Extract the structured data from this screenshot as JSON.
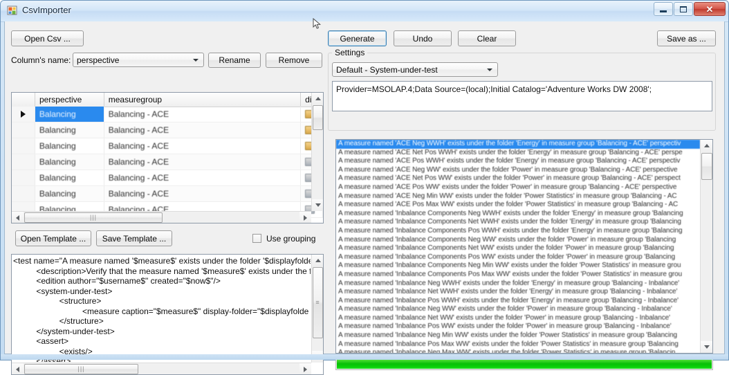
{
  "window": {
    "title": "CsvImporter",
    "icon": "app-window-icon",
    "buttons": {
      "minimize": "minimize-icon",
      "maximize": "maximize-icon",
      "close": "close-icon"
    }
  },
  "toolbar": {
    "open_csv": "Open Csv ...",
    "generate": "Generate",
    "undo": "Undo",
    "clear": "Clear",
    "save_as": "Save as ..."
  },
  "column_row": {
    "label": "Column's name:",
    "combo_value": "perspective",
    "rename": "Rename",
    "remove": "Remove"
  },
  "settings": {
    "group_title": "Settings",
    "profile_combo": "Default - System-under-test",
    "connection_string": "Provider=MSOLAP.4;Data Source=(local);Initial Catalog='Adventure Works DW 2008';"
  },
  "grid": {
    "headers": [
      "",
      "perspective",
      "measuregroup",
      "di"
    ],
    "rows": [
      {
        "perspective": "Balancing",
        "measuregroup": "Balancing - ACE",
        "displayfolder": "folder-icon",
        "selected": true
      },
      {
        "perspective": "Balancing",
        "measuregroup": "Balancing - ACE",
        "displayfolder": "folder-icon",
        "selected": false
      },
      {
        "perspective": "Balancing",
        "measuregroup": "Balancing - ACE",
        "displayfolder": "folder-icon",
        "selected": false
      },
      {
        "perspective": "Balancing",
        "measuregroup": "Balancing - ACE",
        "displayfolder": "folder-icon",
        "selected": false
      },
      {
        "perspective": "Balancing",
        "measuregroup": "Balancing - ACE",
        "displayfolder": "folder-icon",
        "selected": false
      },
      {
        "perspective": "Balancing",
        "measuregroup": "Balancing - ACE",
        "displayfolder": "folder-icon",
        "selected": false
      },
      {
        "perspective": "Balancing",
        "measuregroup": "Balancing - ACE",
        "displayfolder": "folder-icon",
        "selected": false
      }
    ]
  },
  "template_bar": {
    "open_template": "Open Template ...",
    "save_template": "Save Template ...",
    "use_grouping_label": "Use grouping",
    "use_grouping_checked": false
  },
  "template_text": [
    "<test name=\"A measure named '$measure$' exists under the folder '$displayfolder$' in measu",
    "          <description>Verify that the measure named '$measure$' exists under the folder '$d",
    "          <edition author=\"$username$\" created=\"$now$\"/>",
    "          <system-under-test>",
    "                    <structure>",
    "                              <measure caption=\"$measure$\" display-folder=\"$displayfolde",
    "                    </structure>",
    "          </system-under-test>",
    "          <assert>",
    "                    <exists/>",
    "          </assert>"
  ],
  "output_list": {
    "selected_index": 0,
    "items": [
      "A measure named 'ACE Neg WWH' exists under the folder 'Energy' in measure group 'Balancing - ACE' perspectiv",
      "A measure named 'ACE Net Pos WWH' exists under the folder 'Energy' in measure group 'Balancing - ACE' perspe",
      "A measure named 'ACE Pos WWH' exists under the folder 'Energy' in measure group 'Balancing - ACE' perspectiv",
      "A measure named 'ACE Neg WW' exists under the folder 'Power' in measure group 'Balancing - ACE' perspective",
      "A measure named 'ACE Net Pos WW' exists under the folder 'Power' in measure group 'Balancing - ACE' perspect",
      "A measure named 'ACE Pos WW' exists under the folder 'Power' in measure group 'Balancing - ACE' perspective",
      "A measure named 'ACE Neg Min WW' exists under the folder 'Power Statistics' in measure group 'Balancing - AC",
      "A measure named 'ACE Pos Max WW' exists under the folder 'Power Statistics' in measure group 'Balancing - AC",
      "A measure named 'Inbalance Components Neg WWH' exists under the folder 'Energy' in measure group 'Balancing",
      "A measure named 'Inbalance Components Net WWH' exists under the folder 'Energy' in measure group 'Balancing",
      "A measure named 'Inbalance Components Pos WWH' exists under the folder 'Energy' in measure group 'Balancing",
      "A measure named 'Inbalance Components Neg WW' exists under the folder 'Power' in measure group 'Balancing",
      "A measure named 'Inbalance Components Net WW' exists under the folder 'Power' in measure group 'Balancing",
      "A measure named 'Inbalance Components Pos WW' exists under the folder 'Power' in measure group 'Balancing",
      "A measure named 'Inbalance Components Neg Min WW' exists under the folder 'Power Statistics' in measure grou",
      "A measure named 'Inbalance Components Pos Max WW' exists under the folder 'Power Statistics' in measure grou",
      "A measure named 'Inbalance Neg WWH' exists under the folder 'Energy' in measure group 'Balancing - Inbalance'",
      "A measure named 'Inbalance Net WWH' exists under the folder 'Energy' in measure group 'Balancing - Inbalance'",
      "A measure named 'Inbalance Pos WWH' exists under the folder 'Energy' in measure group 'Balancing - Inbalance'",
      "A measure named 'Inbalance Neg WW' exists under the folder 'Power' in measure group 'Balancing - Inbalance'",
      "A measure named 'Inbalance Net WW' exists under the folder 'Power' in measure group 'Balancing - Inbalance'",
      "A measure named 'Inbalance Pos WW' exists under the folder 'Power' in measure group 'Balancing - Inbalance'",
      "A measure named 'Inbalance Neg Min WW' exists under the folder 'Power Statistics' in measure group 'Balancing",
      "A measure named 'Inbalance Pos Max WW' exists under the folder 'Power Statistics' in measure group 'Balancing",
      "A measure named 'Inbalance Neg Max WW' exists under the folder 'Power Statistics' in measure group 'Balancin"
    ]
  },
  "progress": {
    "value": 100,
    "color": "#07c007"
  }
}
